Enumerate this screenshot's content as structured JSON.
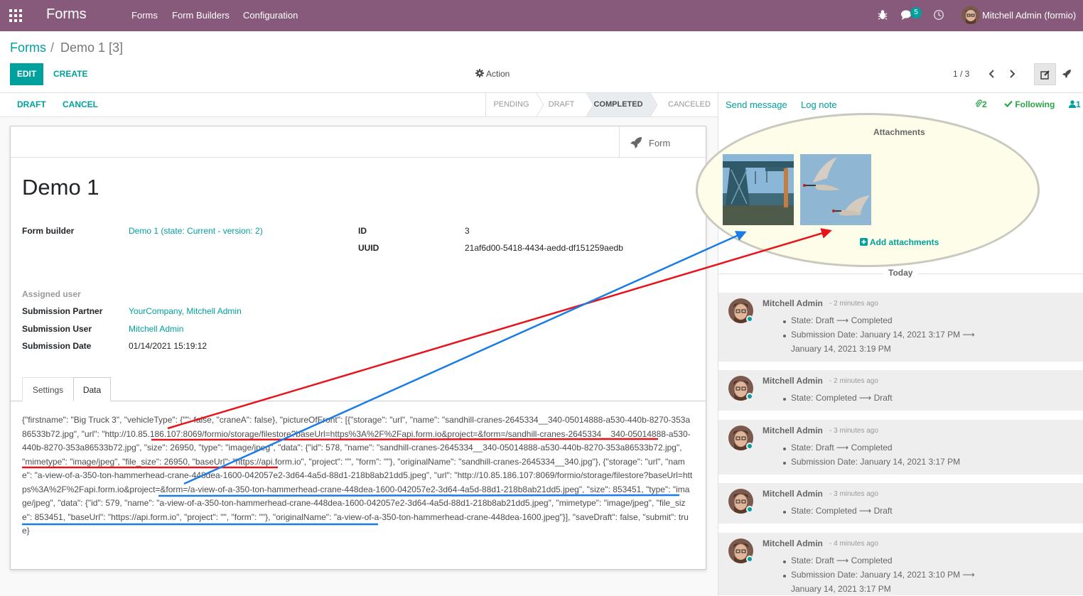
{
  "navbar": {
    "brand": "Forms",
    "menu": [
      "Forms",
      "Form Builders",
      "Configuration"
    ],
    "messages_badge": "5",
    "user": "Mitchell Admin (formio)"
  },
  "breadcrumb": {
    "root": "Forms",
    "separator": "/",
    "current": "Demo 1 [3]"
  },
  "buttons": {
    "edit": "EDIT",
    "create": "CREATE",
    "action": "Action"
  },
  "pager": {
    "value": "1 / 3"
  },
  "statusbar": {
    "draft_button": "DRAFT",
    "cancel_button": "CANCEL",
    "stages": [
      "PENDING",
      "DRAFT",
      "COMPLETED",
      "CANCELED"
    ],
    "active_stage": "COMPLETED"
  },
  "form": {
    "smart_button": "Form",
    "title": "Demo 1",
    "fields": {
      "form_builder_label": "Form builder",
      "form_builder_value": "Demo 1 (state: Current - version: 2)",
      "id_label": "ID",
      "id_value": "3",
      "uuid_label": "UUID",
      "uuid_value": "21af6d00-5418-4434-aedd-df151259aedb",
      "assigned_user_label": "Assigned user",
      "submission_partner_label": "Submission Partner",
      "submission_partner_value": "YourCompany, Mitchell Admin",
      "submission_user_label": "Submission User",
      "submission_user_value": "Mitchell Admin",
      "submission_date_label": "Submission Date",
      "submission_date_value": "01/14/2021 15:19:12"
    },
    "tabs": [
      "Settings",
      "Data"
    ],
    "active_tab": "Data",
    "data_json": "{\"firstname\": \"Big Truck 3\", \"vehicleType\": {\"\": false, \"craneA\": false}, \"pictureOfFront\": [{\"storage\": \"url\", \"name\": \"sandhill-cranes-2645334__340-05014888-a530-440b-8270-353a86533b72.jpg\", \"url\": \"http://10.85.186.107:8069/formio/storage/filestore?baseUrl=https%3A%2F%2Fapi.form.io&project=&form=/sandhill-cranes-2645334__340-05014888-a530-440b-8270-353a86533b72.jpg\", \"size\": 26950, \"type\": \"image/jpeg\", \"data\": {\"id\": 578, \"name\": \"sandhill-cranes-2645334__340-05014888-a530-440b-8270-353a86533b72.jpg\", \"mimetype\": \"image/jpeg\", \"file_size\": 26950, \"baseUrl\": \"https://api.form.io\", \"project\": \"\", \"form\": \"\"}, \"originalName\": \"sandhill-cranes-2645334__340.jpg\"}, {\"storage\": \"url\", \"name\": \"a-view-of-a-350-ton-hammerhead-crane-448dea-1600-042057e2-3d64-4a5d-88d1-218b8ab21dd5.jpeg\", \"url\": \"http://10.85.186.107:8069/formio/storage/filestore?baseUrl=https%3A%2F%2Fapi.form.io&project=&form=/a-view-of-a-350-ton-hammerhead-crane-448dea-1600-042057e2-3d64-4a5d-88d1-218b8ab21dd5.jpeg\", \"size\": 853451, \"type\": \"image/jpeg\", \"data\": {\"id\": 579, \"name\": \"a-view-of-a-350-ton-hammerhead-crane-448dea-1600-042057e2-3d64-4a5d-88d1-218b8ab21dd5.jpeg\", \"mimetype\": \"image/jpeg\", \"file_size\": 853451, \"baseUrl\": \"https://api.form.io\", \"project\": \"\", \"form\": \"\"}, \"originalName\": \"a-view-of-a-350-ton-hammerhead-crane-448dea-1600.jpeg\"}], \"saveDraft\": false, \"submit\": true}"
  },
  "chatter": {
    "send_message": "Send message",
    "log_note": "Log note",
    "attachment_count": "2",
    "following": "Following",
    "followers_count": "1",
    "attachments_title": "Attachments",
    "add_attachments": "Add attachments",
    "today": "Today",
    "messages": [
      {
        "author": "Mitchell Admin",
        "date": "- 2 minutes ago",
        "lines": [
          "State: Draft ⟶ Completed",
          "Submission Date: January 14, 2021 3:17 PM ⟶",
          "January 14, 2021 3:19 PM"
        ],
        "bullets": [
          0,
          1
        ]
      },
      {
        "author": "Mitchell Admin",
        "date": "- 2 minutes ago",
        "lines": [
          "State: Completed ⟶ Draft"
        ],
        "bullets": [
          0
        ]
      },
      {
        "author": "Mitchell Admin",
        "date": "- 3 minutes ago",
        "lines": [
          "State: Draft ⟶ Completed",
          "Submission Date: January 14, 2021 3:17 PM"
        ],
        "bullets": [
          0,
          1
        ]
      },
      {
        "author": "Mitchell Admin",
        "date": "- 3 minutes ago",
        "lines": [
          "State: Completed ⟶ Draft"
        ],
        "bullets": [
          0
        ]
      },
      {
        "author": "Mitchell Admin",
        "date": "- 4 minutes ago",
        "lines": [
          "State: Draft ⟶ Completed",
          "Submission Date: January 14, 2021 3:10 PM ⟶",
          "January 14, 2021 3:17 PM"
        ],
        "bullets": [
          0,
          1
        ]
      }
    ]
  },
  "annotation_colors": {
    "red": "#e8141b",
    "blue": "#1a7de6"
  }
}
